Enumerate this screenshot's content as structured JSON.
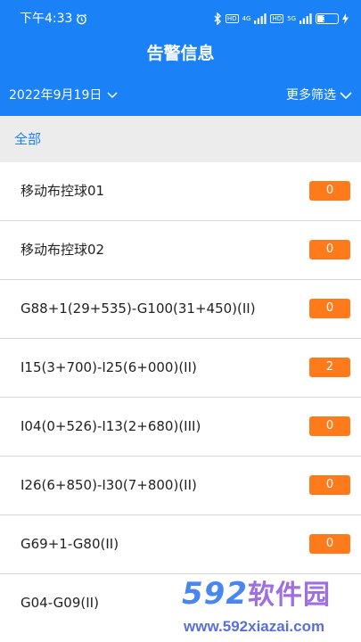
{
  "status_bar": {
    "time": "下午4:33",
    "battery": "35",
    "network_1": "4G",
    "network_2": "5G",
    "icons": [
      "alarm-icon",
      "bluetooth-icon",
      "hd-icon",
      "signal-icon",
      "hd-icon",
      "signal-icon",
      "battery-icon",
      "charging-icon"
    ]
  },
  "header": {
    "title": "告警信息",
    "date_filter": "2022年9月19日",
    "more_filter": "更多筛选",
    "background_color": "#1a82f6"
  },
  "filter_bar": {
    "selected": "全部",
    "accent_color": "#1a82f6"
  },
  "list": {
    "badge_color": "#ff7a1a",
    "items": [
      {
        "label": "移动布控球01",
        "count": "0"
      },
      {
        "label": "移动布控球02",
        "count": "0"
      },
      {
        "label": "G88+1(29+535)-G100(31+450)(II)",
        "count": "0"
      },
      {
        "label": "I15(3+700)-I25(6+000)(II)",
        "count": "2"
      },
      {
        "label": "I04(0+526)-I13(2+680)(III)",
        "count": "0"
      },
      {
        "label": "I26(6+850)-I30(7+800)(II)",
        "count": "0"
      },
      {
        "label": "G69+1-G80(II)",
        "count": "0"
      },
      {
        "label": "G04-G09(II)",
        "count": ""
      }
    ]
  },
  "watermark": {
    "logo_num": "592",
    "logo_cn": "软件园",
    "url": "www.592xiazai.com"
  }
}
